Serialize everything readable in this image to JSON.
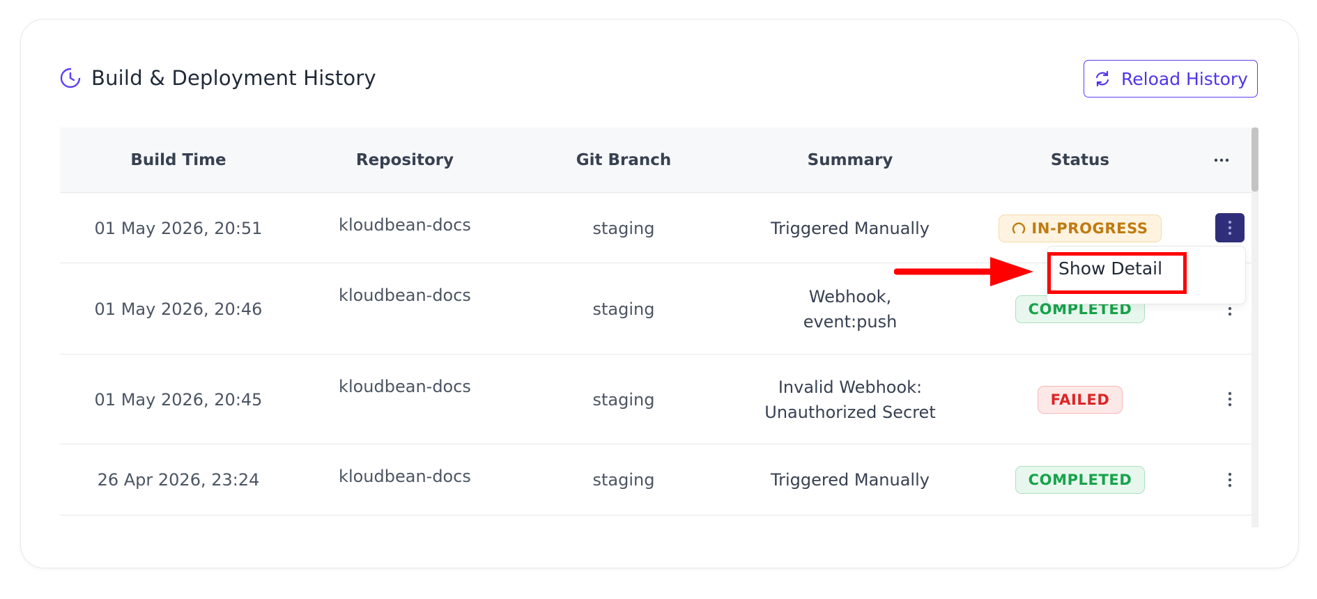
{
  "header": {
    "title": "Build & Deployment History",
    "reload_label": "Reload History"
  },
  "table": {
    "columns": [
      "Build Time",
      "Repository",
      "Git Branch",
      "Summary",
      "Status"
    ],
    "rows": [
      {
        "time": "01 May 2026, 20:51",
        "repo": "kloudbean-docs",
        "branch": "staging",
        "summary_lines": [
          "Triggered Manually"
        ],
        "status": "IN-PROGRESS"
      },
      {
        "time": "01 May 2026, 20:46",
        "repo": "kloudbean-docs",
        "branch": "staging",
        "summary_lines": [
          "Webhook,",
          "event:push"
        ],
        "status": "COMPLETED"
      },
      {
        "time": "01 May 2026, 20:45",
        "repo": "kloudbean-docs",
        "branch": "staging",
        "summary_lines": [
          "Invalid Webhook:",
          "Unauthorized Secret"
        ],
        "status": "FAILED"
      },
      {
        "time": "26 Apr 2026, 23:24",
        "repo": "kloudbean-docs",
        "branch": "staging",
        "summary_lines": [
          "Triggered Manually"
        ],
        "status": "COMPLETED"
      }
    ]
  },
  "dropdown": {
    "item_label": "Show Detail"
  },
  "colors": {
    "accent": "#4f35e8",
    "active_kebab": "#2e2e7a",
    "in_progress": "#c07a10",
    "completed": "#16a34a",
    "failed": "#dc2626",
    "annotation": "#ff0000"
  }
}
